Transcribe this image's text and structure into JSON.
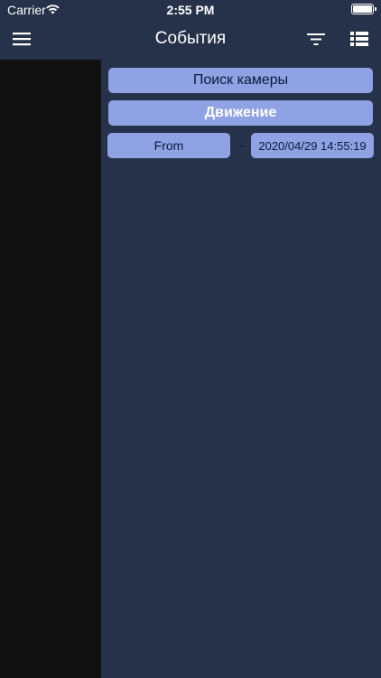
{
  "status_bar": {
    "carrier": "Carrier",
    "time": "2:55 PM",
    "icons": [
      "wifi-icon",
      "battery-icon"
    ]
  },
  "nav_bar": {
    "title": "События",
    "icons": [
      "menu-icon",
      "filter-icon",
      "list-icon"
    ]
  },
  "filters": {
    "camera_search_label": "Поиск камеры",
    "event_type_label": "Движение",
    "date_from_label": "From",
    "range_separator": "-",
    "date_to_value": "2020/04/29 14:55:19"
  },
  "colors": {
    "background": "#263249",
    "left_panel": "#111111",
    "button_fill": "#8ea2e4",
    "button_text": "#0e1a3a",
    "nav_text": "#ffffff"
  }
}
